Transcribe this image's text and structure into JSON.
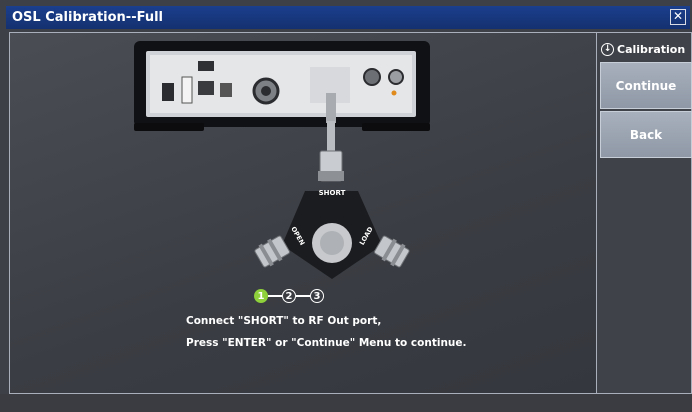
{
  "window": {
    "title": "OSL Calibration--Full",
    "close_glyph": "✕"
  },
  "side_menu": {
    "header_icon": "chevron-down-circle-icon",
    "header_glyph": "↓",
    "header_label": "Calibration",
    "buttons": [
      {
        "label": "Continue"
      },
      {
        "label": "Back"
      }
    ]
  },
  "steps": {
    "items": [
      "1",
      "2",
      "3"
    ],
    "active_index": 0
  },
  "instructions": {
    "line1": "Connect \"SHORT\" to RF Out port,",
    "line2": "Press \"ENTER\" or \"Continue\" Menu to continue."
  },
  "illustration": {
    "kit_labels": {
      "top": "SHORT",
      "left": "OPEN",
      "right": "LOAD"
    }
  },
  "colors": {
    "title_bar": "#17378a",
    "active_step": "#8ed13a",
    "side_button": "#9aa2b0"
  }
}
